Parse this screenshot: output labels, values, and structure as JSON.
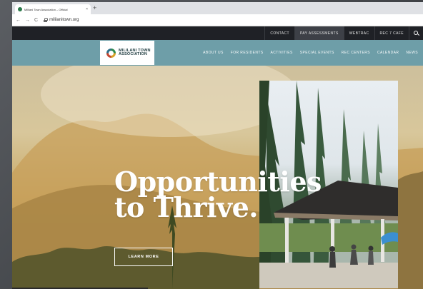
{
  "browser": {
    "tab_title": "Mililani Town Association – Official",
    "tab_close": "×",
    "new_tab": "+",
    "back": "←",
    "forward": "→",
    "reload": "C",
    "url": "mililanitown.org"
  },
  "utility_nav": {
    "items": [
      {
        "label": "CONTACT"
      },
      {
        "label": "PAY ASSESSMENTS"
      },
      {
        "label": "WEBTRAC"
      },
      {
        "label": "REC 7 CAFE"
      }
    ],
    "search_icon": "search-icon"
  },
  "logo": {
    "line1": "MILILANI TOWN",
    "line2": "ASSOCIATION"
  },
  "main_nav": {
    "items": [
      {
        "label": "ABOUT US"
      },
      {
        "label": "FOR RESIDENTS"
      },
      {
        "label": "ACTIVITIES"
      },
      {
        "label": "SPECIAL EVENTS"
      },
      {
        "label": "REC CENTERS"
      },
      {
        "label": "CALENDAR"
      },
      {
        "label": "NEWS"
      }
    ]
  },
  "hero": {
    "headline_line1": "Opportunities",
    "headline_line2": "to Thrive.",
    "cta_label": "LEARN MORE"
  },
  "colors": {
    "utility_bar": "#1f2126",
    "main_nav": "#6e9ea8",
    "hero_tint": "#d8c79b"
  }
}
